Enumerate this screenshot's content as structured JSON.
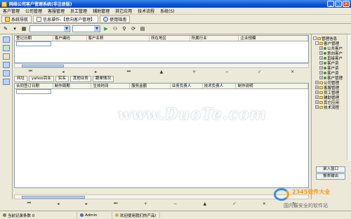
{
  "window": {
    "title": "网络公司客户管理系统(非注册版)"
  },
  "menu": [
    "客户管理",
    "公司管理",
    "客服管理",
    "员工管理",
    "辅助管理",
    "其它应用",
    "技术流程",
    "系统(S)"
  ],
  "tabs": [
    {
      "label": "系统导航"
    },
    {
      "label": "信息操作-【意向客户管理】"
    },
    {
      "label": "使用指南"
    }
  ],
  "grid1": {
    "columns": [
      "登记日期",
      "客户编码",
      "客户名称",
      "所在地区",
      "所属行业",
      "企业规模"
    ],
    "filter_value": ""
  },
  "subtabs": [
    "网址",
    "yahoo百业",
    "实名",
    "其他业务",
    "跟单情况"
  ],
  "grid2": {
    "columns": [
      "合同签订日期",
      "制作周期",
      "生效时间",
      "服务金额",
      "业务负责人",
      "技术负责人",
      "制作说明"
    ]
  },
  "tree": {
    "root": "管理信息",
    "items": [
      {
        "label": "客户管理",
        "level": 1,
        "toggle": "-"
      },
      {
        "label": "公共客户",
        "level": 2,
        "toggle": "+"
      },
      {
        "label": "意向客户",
        "level": 2,
        "toggle": "+"
      },
      {
        "label": "直接客户",
        "level": 2,
        "toggle": "+"
      },
      {
        "label": "客户资",
        "level": 2,
        "toggle": "+"
      },
      {
        "label": "客户资",
        "level": 2,
        "toggle": "+"
      },
      {
        "label": "客户资",
        "level": 2,
        "toggle": "+"
      },
      {
        "label": "客户管理",
        "level": 2,
        "toggle": "+"
      },
      {
        "label": "公司管理",
        "level": 1,
        "toggle": "+"
      },
      {
        "label": "客服管理",
        "level": 1,
        "toggle": "+"
      },
      {
        "label": "员工管理",
        "level": 1,
        "toggle": "+"
      },
      {
        "label": "辅助管理",
        "level": 1,
        "toggle": "+"
      },
      {
        "label": "其它应用",
        "level": 1,
        "toggle": "+"
      },
      {
        "label": "技术流程",
        "level": 1,
        "toggle": "+"
      }
    ],
    "buttons": [
      "录入窗口",
      "报表输出"
    ]
  },
  "statusbar": {
    "record_count": "当前记录条数 0",
    "user": "Admin",
    "welcome": "欢迎使用我们的产品!"
  },
  "watermark": "www.DuoTe.com",
  "logo": {
    "line1": "2345软件大全",
    "line2": "国内最安全的软件站"
  }
}
